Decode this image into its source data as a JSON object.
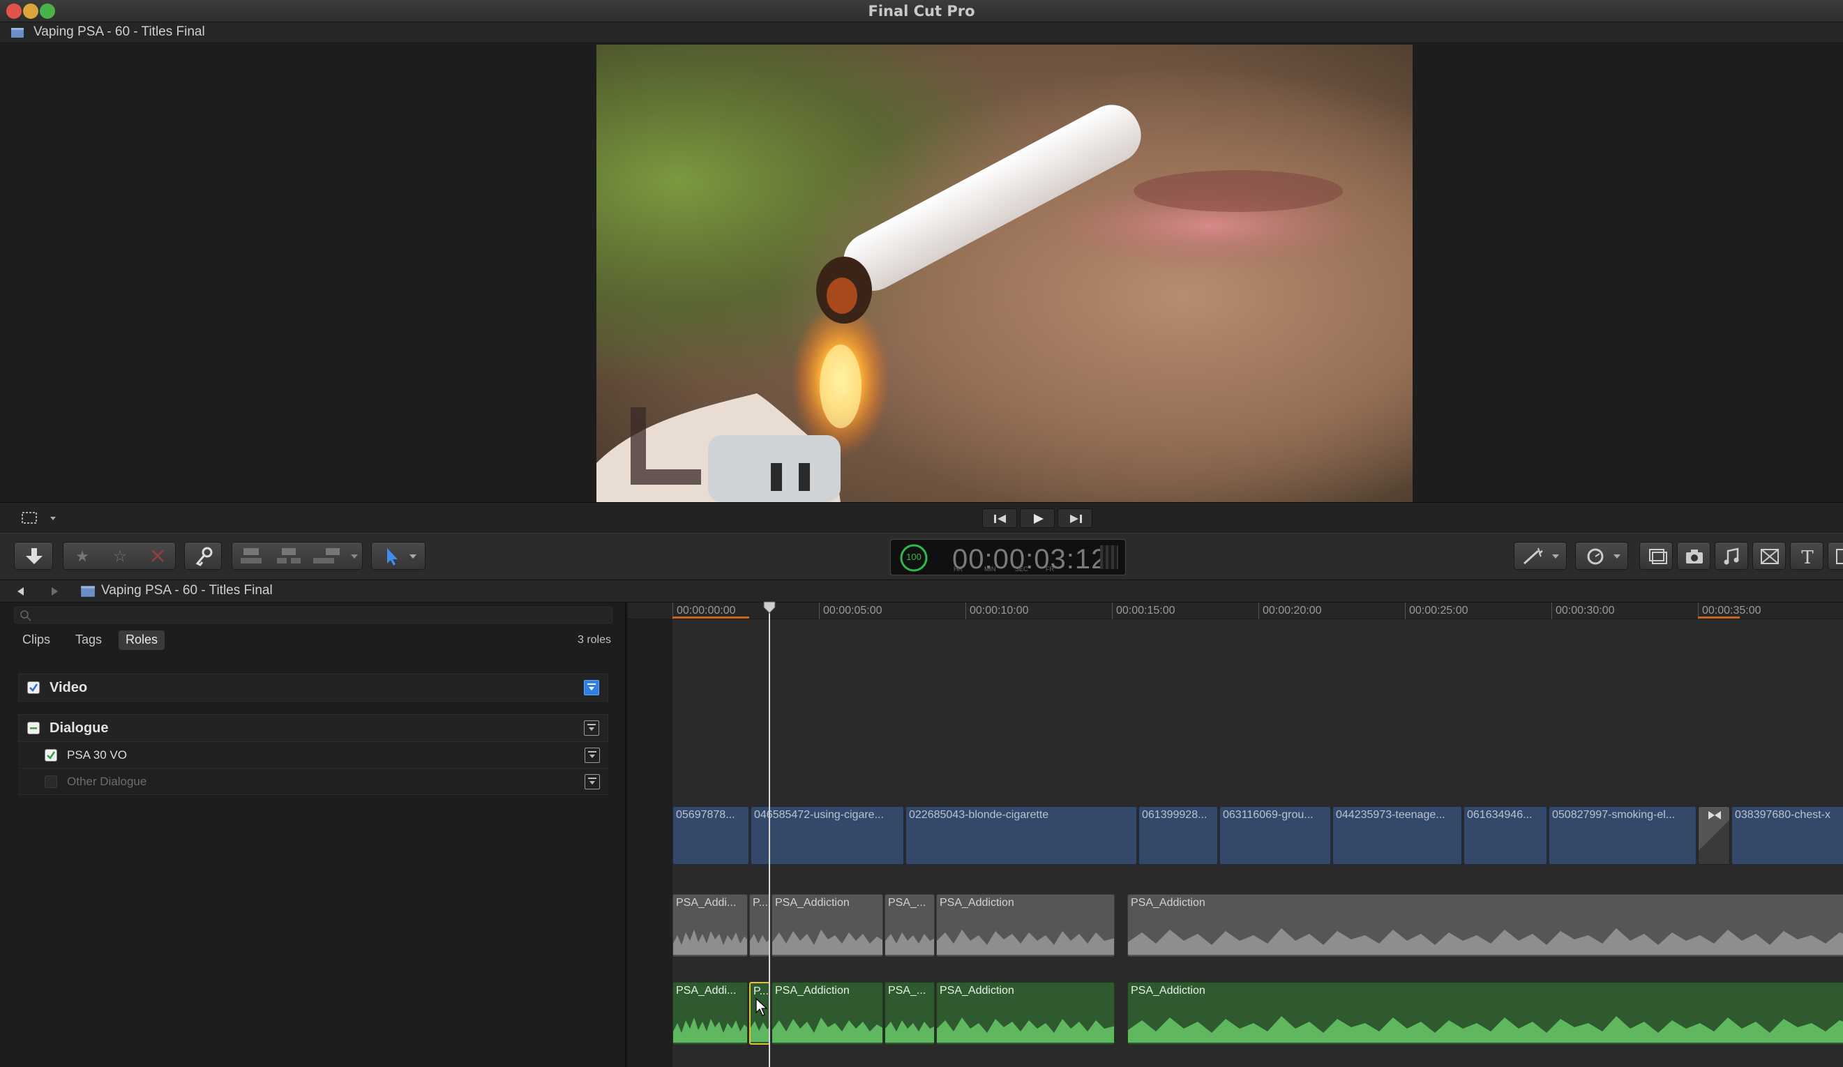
{
  "app": {
    "title": "Final Cut Pro"
  },
  "viewer": {
    "title": "Vaping PSA - 60 - Titles Final"
  },
  "toolbar": {
    "timecode": "00:00:03:12",
    "timecode_percent": "100",
    "timecode_units": [
      "HR",
      "MIN",
      "SEC",
      "FR"
    ]
  },
  "timeline": {
    "project_title": "Vaping PSA - 60 - Titles Final",
    "ruler": [
      "00:00:00:00",
      "00:00:05:00",
      "00:00:10:00",
      "00:00:15:00",
      "00:00:20:00",
      "00:00:25:00",
      "00:00:30:00",
      "00:00:35:00"
    ],
    "video_clips": [
      "05697878...",
      "046585472-using-cigare...",
      "022685043-blonde-cigarette",
      "061399928...",
      "063116069-grou...",
      "044235973-teenage...",
      "061634946...",
      "050827997-smoking-el...",
      "038397680-chest-x"
    ],
    "audio_track_1": [
      "PSA_Addi...",
      "P...",
      "PSA_Addiction",
      "PSA_...",
      "PSA_Addiction",
      "PSA_Addiction"
    ],
    "audio_track_2": [
      "PSA_Addi...",
      "P...",
      "PSA_Addiction",
      "PSA_...",
      "PSA_Addiction",
      "PSA_Addiction"
    ]
  },
  "roles_index": {
    "tabs": [
      "Clips",
      "Tags",
      "Roles"
    ],
    "active_tab": "Roles",
    "count": "3 roles",
    "roles": [
      {
        "label": "Video",
        "checked": true
      },
      {
        "label": "Dialogue",
        "checked": "mixed",
        "children": [
          {
            "label": "PSA 30 VO",
            "checked": true
          },
          {
            "label": "Other Dialogue",
            "checked": false
          }
        ]
      }
    ]
  },
  "colors": {
    "accent": "#2e7fe8",
    "video_clip": "#34486a",
    "audio_dialogue": "#2f5a2f",
    "selection": "#e0c53a"
  }
}
